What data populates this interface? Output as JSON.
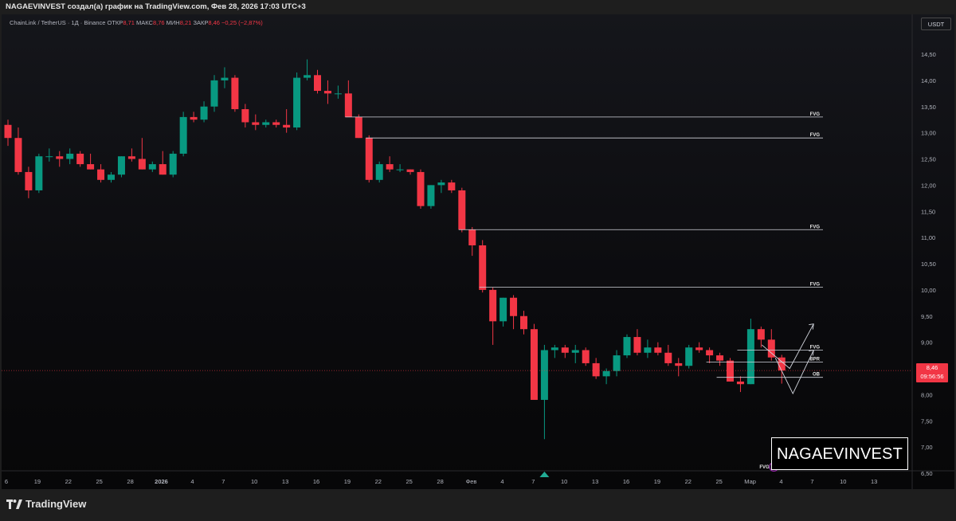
{
  "header": {
    "title": "NAGAEVINVEST создал(а) график на TradingView.com, Фев 28, 2026 17:03 UTC+3"
  },
  "legend": {
    "symbol": "ChainLink / TetherUS · 1Д · Binance",
    "open_label": "ОТКР",
    "open": "8,71",
    "high_label": "МАКС",
    "high": "8,76",
    "low_label": "МИН",
    "low": "8,21",
    "close_label": "ЗАКР",
    "close": "8,46",
    "change": "−0,25 (−2,87%)"
  },
  "currency_button": "USDT",
  "price_tag": {
    "price": "8,46",
    "countdown": "09:56:56"
  },
  "brand_box": "NAGAEVINVEST",
  "footer_logo": "TradingView",
  "colors": {
    "up": "#089981",
    "down": "#f23645",
    "line": "#d1d4dc"
  },
  "chart_data": {
    "type": "candlestick",
    "y_ticks": [
      "14,50",
      "14,00",
      "13,50",
      "13,00",
      "12,50",
      "12,00",
      "11,50",
      "11,00",
      "10,50",
      "10,00",
      "9,50",
      "9,00",
      "8,50",
      "8,00",
      "7,50",
      "7,00",
      "6,50"
    ],
    "ylim": [
      6.5,
      15.0
    ],
    "x_ticks": [
      "6",
      "19",
      "22",
      "25",
      "28",
      "2026",
      "4",
      "7",
      "10",
      "13",
      "16",
      "19",
      "22",
      "25",
      "28",
      "Фев",
      "4",
      "7",
      "10",
      "13",
      "16",
      "19",
      "22",
      "25",
      "Мар",
      "4",
      "7",
      "10",
      "13"
    ],
    "candles": [
      {
        "o": 13.15,
        "h": 13.25,
        "l": 12.75,
        "c": 12.9
      },
      {
        "o": 12.9,
        "h": 13.1,
        "l": 12.2,
        "c": 12.25
      },
      {
        "o": 12.25,
        "h": 12.35,
        "l": 11.75,
        "c": 11.9
      },
      {
        "o": 11.9,
        "h": 12.6,
        "l": 11.85,
        "c": 12.55
      },
      {
        "o": 12.55,
        "h": 12.7,
        "l": 12.45,
        "c": 12.55
      },
      {
        "o": 12.55,
        "h": 12.65,
        "l": 12.35,
        "c": 12.5
      },
      {
        "o": 12.5,
        "h": 12.7,
        "l": 12.4,
        "c": 12.6
      },
      {
        "o": 12.6,
        "h": 12.65,
        "l": 12.35,
        "c": 12.4
      },
      {
        "o": 12.4,
        "h": 12.6,
        "l": 12.3,
        "c": 12.3
      },
      {
        "o": 12.3,
        "h": 12.4,
        "l": 12.05,
        "c": 12.1
      },
      {
        "o": 12.1,
        "h": 12.25,
        "l": 12.05,
        "c": 12.2
      },
      {
        "o": 12.2,
        "h": 12.55,
        "l": 12.15,
        "c": 12.55
      },
      {
        "o": 12.55,
        "h": 12.7,
        "l": 12.45,
        "c": 12.5
      },
      {
        "o": 12.5,
        "h": 12.9,
        "l": 12.3,
        "c": 12.3
      },
      {
        "o": 12.3,
        "h": 12.45,
        "l": 12.25,
        "c": 12.4
      },
      {
        "o": 12.4,
        "h": 12.65,
        "l": 12.2,
        "c": 12.2
      },
      {
        "o": 12.2,
        "h": 12.65,
        "l": 12.15,
        "c": 12.6
      },
      {
        "o": 12.6,
        "h": 13.4,
        "l": 12.55,
        "c": 13.3
      },
      {
        "o": 13.3,
        "h": 13.4,
        "l": 13.2,
        "c": 13.25
      },
      {
        "o": 13.25,
        "h": 13.6,
        "l": 13.2,
        "c": 13.5
      },
      {
        "o": 13.5,
        "h": 14.1,
        "l": 13.4,
        "c": 14.0
      },
      {
        "o": 14.0,
        "h": 14.25,
        "l": 13.85,
        "c": 14.05
      },
      {
        "o": 14.05,
        "h": 14.1,
        "l": 13.4,
        "c": 13.45
      },
      {
        "o": 13.45,
        "h": 13.55,
        "l": 13.1,
        "c": 13.2
      },
      {
        "o": 13.2,
        "h": 13.35,
        "l": 13.05,
        "c": 13.15
      },
      {
        "o": 13.15,
        "h": 13.25,
        "l": 13.1,
        "c": 13.2
      },
      {
        "o": 13.2,
        "h": 13.25,
        "l": 13.1,
        "c": 13.15
      },
      {
        "o": 13.15,
        "h": 13.45,
        "l": 13.0,
        "c": 13.1
      },
      {
        "o": 13.1,
        "h": 14.15,
        "l": 13.05,
        "c": 14.05
      },
      {
        "o": 14.05,
        "h": 14.4,
        "l": 14.0,
        "c": 14.1
      },
      {
        "o": 14.1,
        "h": 14.2,
        "l": 13.75,
        "c": 13.8
      },
      {
        "o": 13.8,
        "h": 14.0,
        "l": 13.55,
        "c": 13.75
      },
      {
        "o": 13.75,
        "h": 13.9,
        "l": 13.65,
        "c": 13.75
      },
      {
        "o": 13.75,
        "h": 14.0,
        "l": 13.3,
        "c": 13.3
      },
      {
        "o": 13.3,
        "h": 13.35,
        "l": 12.9,
        "c": 12.9
      },
      {
        "o": 12.9,
        "h": 12.95,
        "l": 12.05,
        "c": 12.1
      },
      {
        "o": 12.1,
        "h": 12.45,
        "l": 12.05,
        "c": 12.4
      },
      {
        "o": 12.4,
        "h": 12.55,
        "l": 12.25,
        "c": 12.3
      },
      {
        "o": 12.3,
        "h": 12.4,
        "l": 12.25,
        "c": 12.3
      },
      {
        "o": 12.3,
        "h": 12.3,
        "l": 12.2,
        "c": 12.25
      },
      {
        "o": 12.25,
        "h": 12.3,
        "l": 11.55,
        "c": 11.6
      },
      {
        "o": 11.6,
        "h": 12.0,
        "l": 11.55,
        "c": 12.0
      },
      {
        "o": 12.0,
        "h": 12.1,
        "l": 11.85,
        "c": 12.05
      },
      {
        "o": 12.05,
        "h": 12.1,
        "l": 11.85,
        "c": 11.9
      },
      {
        "o": 11.9,
        "h": 11.95,
        "l": 11.1,
        "c": 11.15
      },
      {
        "o": 11.15,
        "h": 11.2,
        "l": 10.65,
        "c": 10.85
      },
      {
        "o": 10.85,
        "h": 10.95,
        "l": 9.95,
        "c": 10.0
      },
      {
        "o": 10.0,
        "h": 10.05,
        "l": 8.95,
        "c": 9.4
      },
      {
        "o": 9.4,
        "h": 9.85,
        "l": 9.3,
        "c": 9.85
      },
      {
        "o": 9.85,
        "h": 9.9,
        "l": 9.25,
        "c": 9.5
      },
      {
        "o": 9.5,
        "h": 9.6,
        "l": 9.15,
        "c": 9.25
      },
      {
        "o": 9.25,
        "h": 9.35,
        "l": 7.95,
        "c": 7.9
      },
      {
        "o": 7.9,
        "h": 8.95,
        "l": 7.15,
        "c": 8.85
      },
      {
        "o": 8.85,
        "h": 8.95,
        "l": 8.7,
        "c": 8.9
      },
      {
        "o": 8.9,
        "h": 8.95,
        "l": 8.7,
        "c": 8.8
      },
      {
        "o": 8.8,
        "h": 8.95,
        "l": 8.6,
        "c": 8.85
      },
      {
        "o": 8.85,
        "h": 8.9,
        "l": 8.55,
        "c": 8.6
      },
      {
        "o": 8.6,
        "h": 8.7,
        "l": 8.3,
        "c": 8.35
      },
      {
        "o": 8.35,
        "h": 8.5,
        "l": 8.2,
        "c": 8.45
      },
      {
        "o": 8.45,
        "h": 8.85,
        "l": 8.35,
        "c": 8.75
      },
      {
        "o": 8.75,
        "h": 9.15,
        "l": 8.7,
        "c": 9.1
      },
      {
        "o": 9.1,
        "h": 9.25,
        "l": 8.75,
        "c": 8.8
      },
      {
        "o": 8.8,
        "h": 9.05,
        "l": 8.7,
        "c": 8.9
      },
      {
        "o": 8.9,
        "h": 9.0,
        "l": 8.75,
        "c": 8.8
      },
      {
        "o": 8.8,
        "h": 8.95,
        "l": 8.55,
        "c": 8.6
      },
      {
        "o": 8.6,
        "h": 8.7,
        "l": 8.35,
        "c": 8.55
      },
      {
        "o": 8.55,
        "h": 8.95,
        "l": 8.5,
        "c": 8.9
      },
      {
        "o": 8.9,
        "h": 9.0,
        "l": 8.8,
        "c": 8.85
      },
      {
        "o": 8.85,
        "h": 8.9,
        "l": 8.6,
        "c": 8.75
      },
      {
        "o": 8.75,
        "h": 8.8,
        "l": 8.55,
        "c": 8.65
      },
      {
        "o": 8.65,
        "h": 8.7,
        "l": 8.25,
        "c": 8.25
      },
      {
        "o": 8.25,
        "h": 8.35,
        "l": 8.05,
        "c": 8.2
      },
      {
        "o": 8.2,
        "h": 9.45,
        "l": 8.2,
        "c": 9.25
      },
      {
        "o": 9.25,
        "h": 9.3,
        "l": 8.9,
        "c": 9.05
      },
      {
        "o": 9.05,
        "h": 9.25,
        "l": 8.65,
        "c": 8.71
      },
      {
        "o": 8.71,
        "h": 8.76,
        "l": 8.21,
        "c": 8.46
      }
    ],
    "zones": [
      {
        "label": "FVG",
        "price": 13.3
      },
      {
        "label": "FVG",
        "price": 12.9
      },
      {
        "label": "FVG",
        "price": 11.15
      },
      {
        "label": "FVG",
        "price": 10.05
      },
      {
        "label": "FVG",
        "price": 8.85
      },
      {
        "label": "BPR",
        "price": 8.62
      },
      {
        "label": "OB",
        "price": 8.33
      }
    ],
    "bottom_marker": "FVG",
    "last_price": 8.46
  }
}
